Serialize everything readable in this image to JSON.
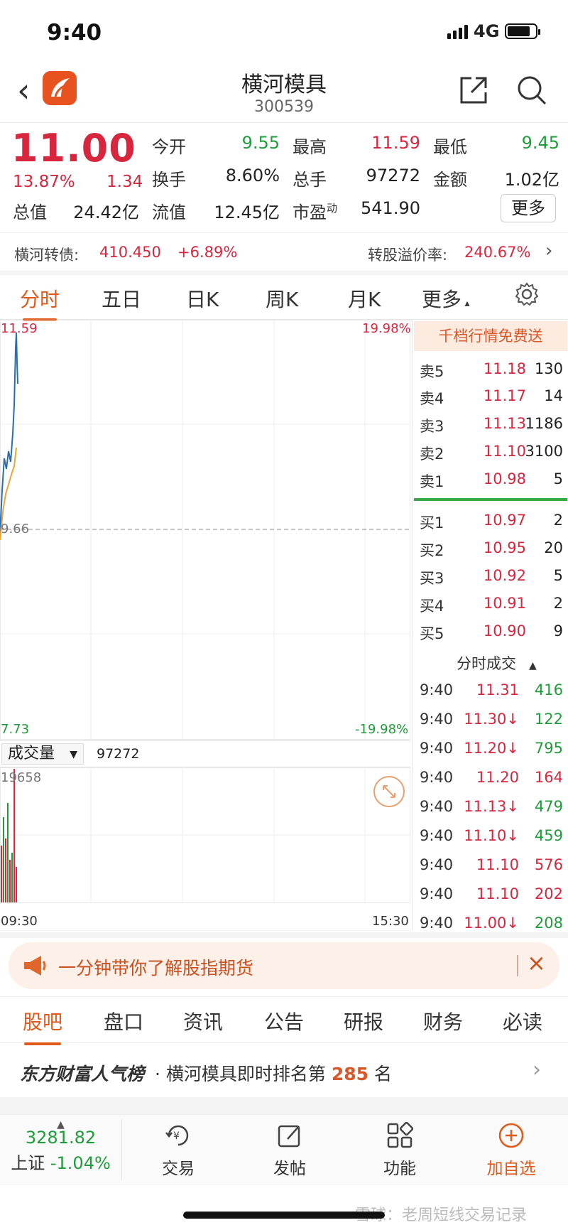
{
  "status": {
    "time": "9:40",
    "network": "4G"
  },
  "header": {
    "title": "横河模具",
    "code": "300539"
  },
  "quote": {
    "price": "11.00",
    "change_pct": "13.87%",
    "change_abs": "1.34",
    "open_label": "今开",
    "open": "9.55",
    "high_label": "最高",
    "high": "11.59",
    "low_label": "最低",
    "low": "9.45",
    "turnover_label": "换手",
    "turnover": "8.60%",
    "volume_label": "总手",
    "volume": "97272",
    "amount_label": "金额",
    "amount": "1.02亿",
    "mcap_label": "总值",
    "mcap": "24.42亿",
    "float_label": "流值",
    "float": "12.45亿",
    "pe_label": "市盈",
    "pe_sup": "动",
    "pe": "541.90",
    "more_label": "更多"
  },
  "bond": {
    "label": "横河转债:",
    "price": "410.450",
    "change": "+6.89%",
    "premium_label": "转股溢价率:",
    "premium": "240.67%"
  },
  "chart_tabs": [
    "分时",
    "五日",
    "日K",
    "周K",
    "月K",
    "更多"
  ],
  "chart": {
    "high_label": "11.59",
    "high_pct": "19.98%",
    "mid_label": "9.66",
    "low_label": "7.73",
    "low_pct": "-19.98%",
    "volume_selector": "成交量",
    "volume_value": "97272",
    "volume_max": "19658",
    "time_start": "09:30",
    "time_end": "15:30"
  },
  "chart_data": {
    "type": "line",
    "ylim": [
      7.73,
      11.59
    ],
    "series": [],
    "volume": []
  },
  "book": {
    "banner": "千档行情免费送",
    "asks": [
      {
        "label": "卖5",
        "price": "11.18",
        "qty": "130"
      },
      {
        "label": "卖4",
        "price": "11.17",
        "qty": "14"
      },
      {
        "label": "卖3",
        "price": "11.13",
        "qty": "1186"
      },
      {
        "label": "卖2",
        "price": "11.10",
        "qty": "3100"
      },
      {
        "label": "卖1",
        "price": "10.98",
        "qty": "5"
      }
    ],
    "bids": [
      {
        "label": "买1",
        "price": "10.97",
        "qty": "2"
      },
      {
        "label": "买2",
        "price": "10.95",
        "qty": "20"
      },
      {
        "label": "买3",
        "price": "10.92",
        "qty": "5"
      },
      {
        "label": "买4",
        "price": "10.91",
        "qty": "2"
      },
      {
        "label": "买5",
        "price": "10.90",
        "qty": "9"
      }
    ],
    "trades_title": "分时成交",
    "trades": [
      {
        "time": "9:40",
        "price": "11.31",
        "qty": "416",
        "dir": "green"
      },
      {
        "time": "9:40",
        "price": "11.30↓",
        "qty": "122",
        "dir": "green"
      },
      {
        "time": "9:40",
        "price": "11.20↓",
        "qty": "795",
        "dir": "green"
      },
      {
        "time": "9:40",
        "price": "11.20",
        "qty": "164",
        "dir": "red"
      },
      {
        "time": "9:40",
        "price": "11.13↓",
        "qty": "479",
        "dir": "green"
      },
      {
        "time": "9:40",
        "price": "11.10↓",
        "qty": "459",
        "dir": "green"
      },
      {
        "time": "9:40",
        "price": "11.10",
        "qty": "576",
        "dir": "red"
      },
      {
        "time": "9:40",
        "price": "11.10",
        "qty": "202",
        "dir": "red"
      },
      {
        "time": "9:40",
        "price": "11.00↓",
        "qty": "208",
        "dir": "green"
      }
    ]
  },
  "promo": {
    "text": "一分钟带你了解股指期货"
  },
  "bottom_tabs": [
    "股吧",
    "盘口",
    "资讯",
    "公告",
    "研报",
    "财务",
    "必读"
  ],
  "rank": {
    "brand": "东方财富人气榜",
    "text_prefix": "· 横河模具即时排名第 ",
    "rank": "285",
    "text_suffix": " 名"
  },
  "nav": {
    "index_value": "3281.82",
    "index_name": "上证",
    "index_change": "-1.04%",
    "trade": "交易",
    "post": "发帖",
    "functions": "功能",
    "add_watch": "加自选"
  },
  "watermark": "雪球：老周短线交易记录",
  "colors": {
    "up": "#d7263d",
    "down": "#1f9d3a",
    "accent": "#e05a1b",
    "price_line": "#2a6cb5",
    "avg_line": "#e9a53a"
  }
}
